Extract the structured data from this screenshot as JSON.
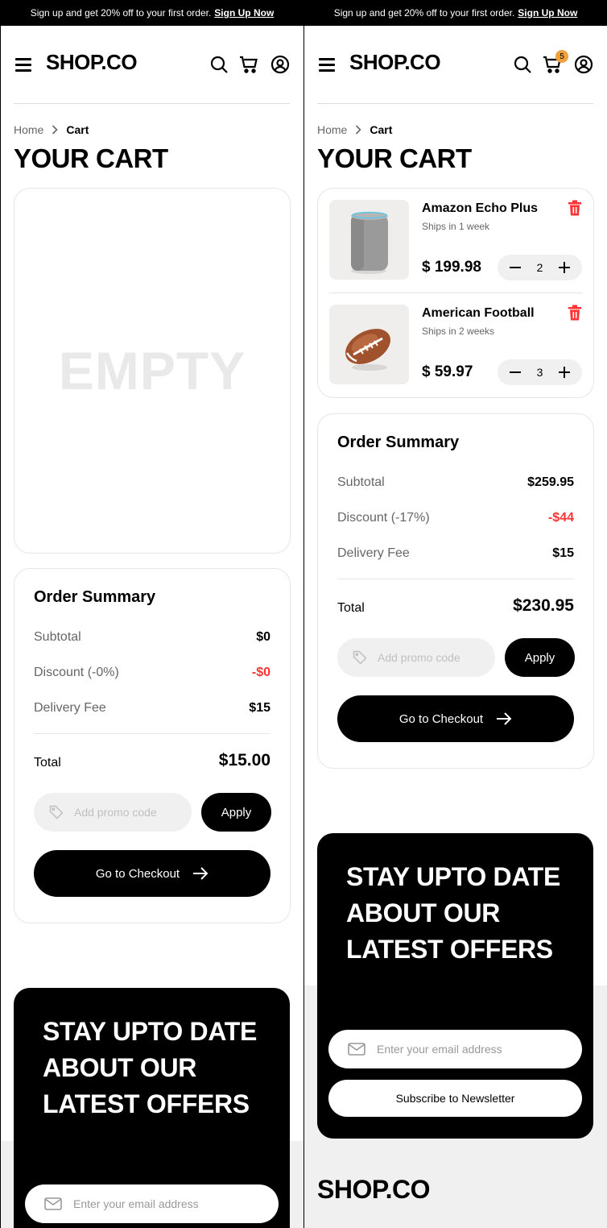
{
  "promo": {
    "text": "Sign up and get 20% off to your first order.",
    "link": "Sign Up Now"
  },
  "brand": {
    "logo": "SHOP.CO"
  },
  "header": {
    "cart_badge": "5"
  },
  "breadcrumb": {
    "home": "Home",
    "current": "Cart"
  },
  "page_title": "YOUR CART",
  "empty_state": "EMPTY",
  "colors": {
    "accent": "#000000",
    "discount": "#ff3333",
    "badge": "#f0a03c"
  },
  "left": {
    "summary": {
      "title": "Order Summary",
      "subtotal_label": "Subtotal",
      "subtotal": "$0",
      "discount_label": "Discount (-0%)",
      "discount": "-$0",
      "delivery_label": "Delivery Fee",
      "delivery": "$15",
      "total_label": "Total",
      "total": "$15.00",
      "promo_placeholder": "Add promo code",
      "apply": "Apply",
      "checkout": "Go to Checkout"
    }
  },
  "right": {
    "items": [
      {
        "name": "Amazon Echo Plus",
        "shipping": "Ships in 1 week",
        "price": "$ 199.98",
        "qty": "2"
      },
      {
        "name": "American Football",
        "shipping": "Ships in 2 weeks",
        "price": "$ 59.97",
        "qty": "3"
      }
    ],
    "summary": {
      "title": "Order Summary",
      "subtotal_label": "Subtotal",
      "subtotal": "$259.95",
      "discount_label": "Discount (-17%)",
      "discount": "-$44",
      "delivery_label": "Delivery Fee",
      "delivery": "$15",
      "total_label": "Total",
      "total": "$230.95",
      "promo_placeholder": "Add promo code",
      "apply": "Apply",
      "checkout": "Go to Checkout"
    }
  },
  "newsletter": {
    "title": "STAY UPTO DATE ABOUT OUR LATEST OFFERS",
    "email_placeholder": "Enter your email address",
    "subscribe": "Subscribe to Newsletter"
  }
}
